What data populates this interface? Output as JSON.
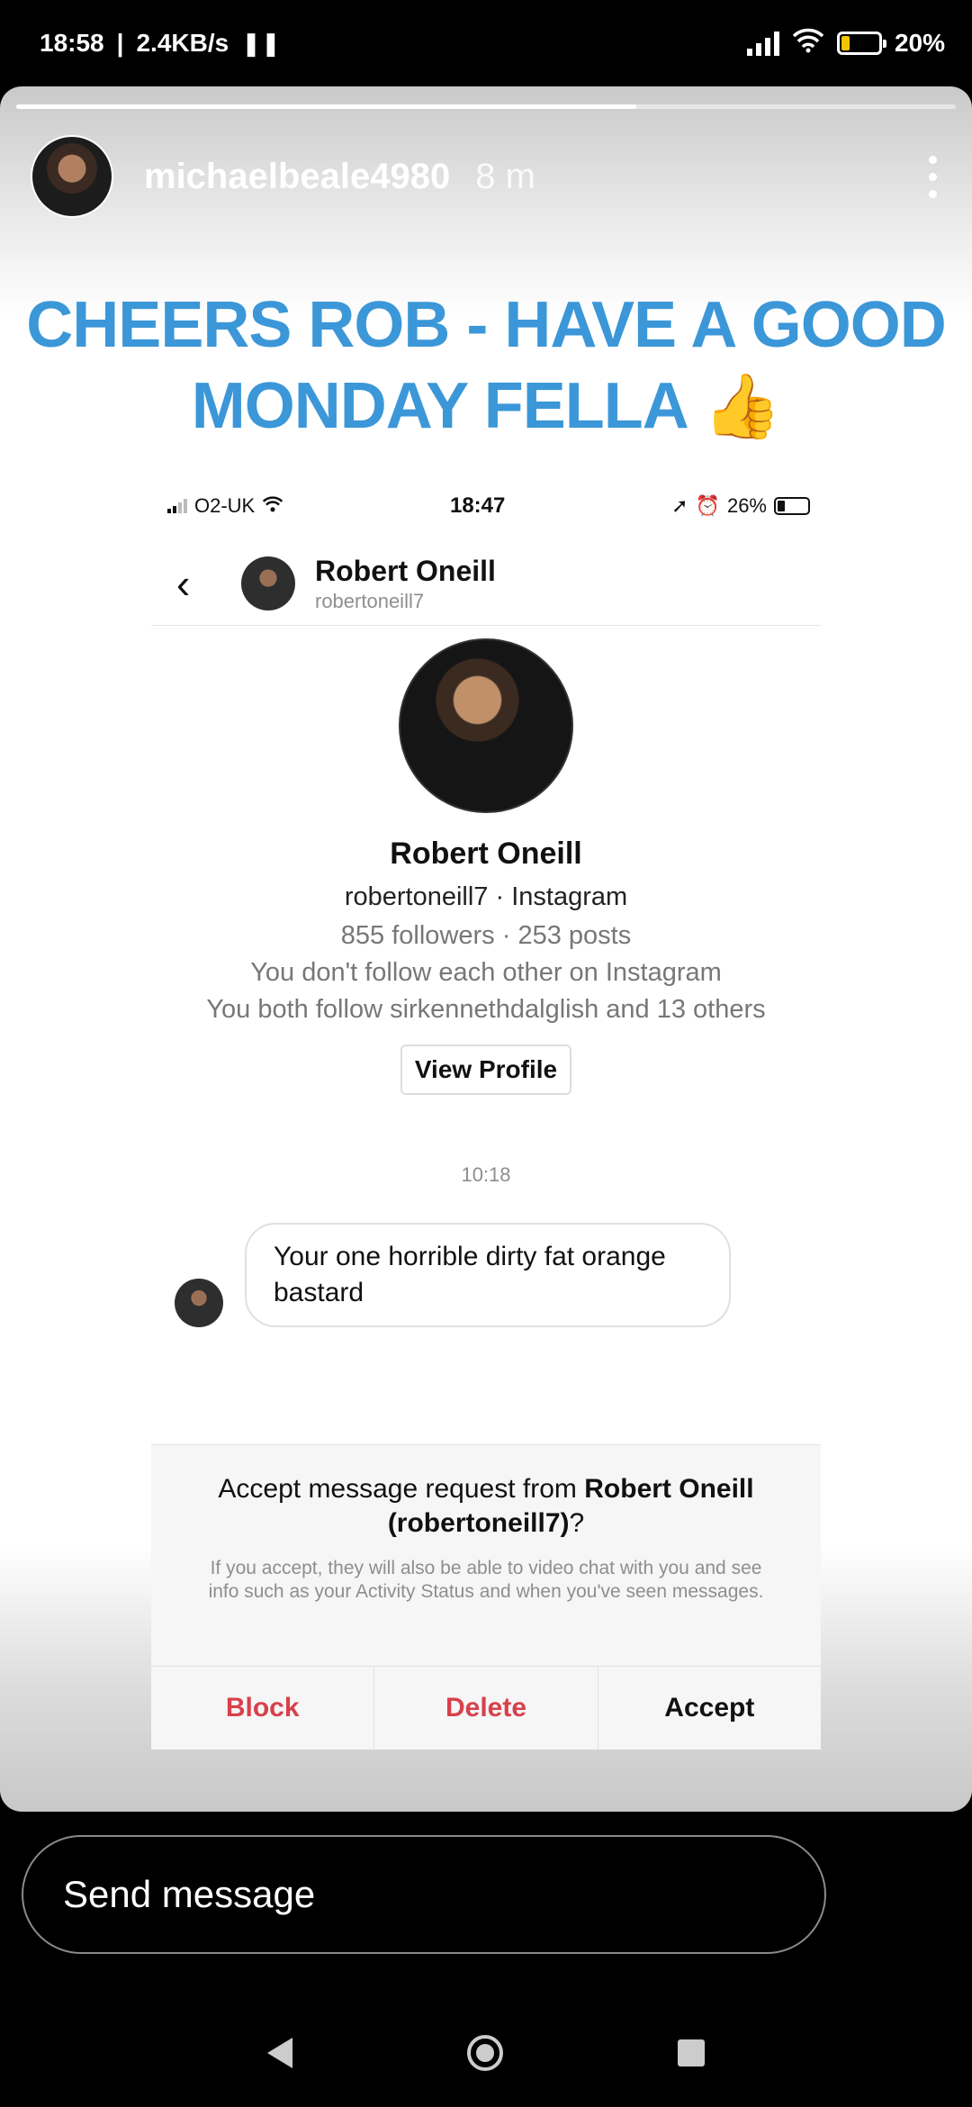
{
  "status_bar": {
    "time": "18:58",
    "speed": "2.4KB/s",
    "pause_icon": "pause-icon",
    "battery": "20%"
  },
  "story": {
    "username": "michaelbeale4980",
    "time_ago": "8 m",
    "progress_fraction": 0.66,
    "caption_line1": "CHEERS ROB - HAVE A GOOD",
    "caption_line2": "MONDAY FELLA",
    "caption_emoji": "👍"
  },
  "screenshot": {
    "carrier": "O2-UK",
    "time": "18:47",
    "battery": "26%",
    "header_name": "Robert Oneill",
    "header_username": "robertoneill7",
    "profile_name": "Robert Oneill",
    "profile_line1": "robertoneill7 · Instagram",
    "profile_line2": "855 followers · 253 posts",
    "profile_line3": "You don't follow each other on Instagram",
    "profile_line4": "You both follow sirkennethdalglish and 13 others",
    "view_profile": "View Profile",
    "timestamp": "10:18",
    "message": "Your one horrible dirty fat orange bastard",
    "request_prefix": "Accept message request from ",
    "request_name": "Robert Oneill",
    "request_handle": "(robertoneill7)",
    "request_suffix": "?",
    "request_sub": "If you accept, they will also be able to video chat with you and see info such as your Activity Status and when you've seen messages.",
    "btn_block": "Block",
    "btn_delete": "Delete",
    "btn_accept": "Accept"
  },
  "reply": {
    "placeholder": "Send message"
  },
  "colors": {
    "caption": "#3b97d8",
    "danger": "#d8404b"
  }
}
